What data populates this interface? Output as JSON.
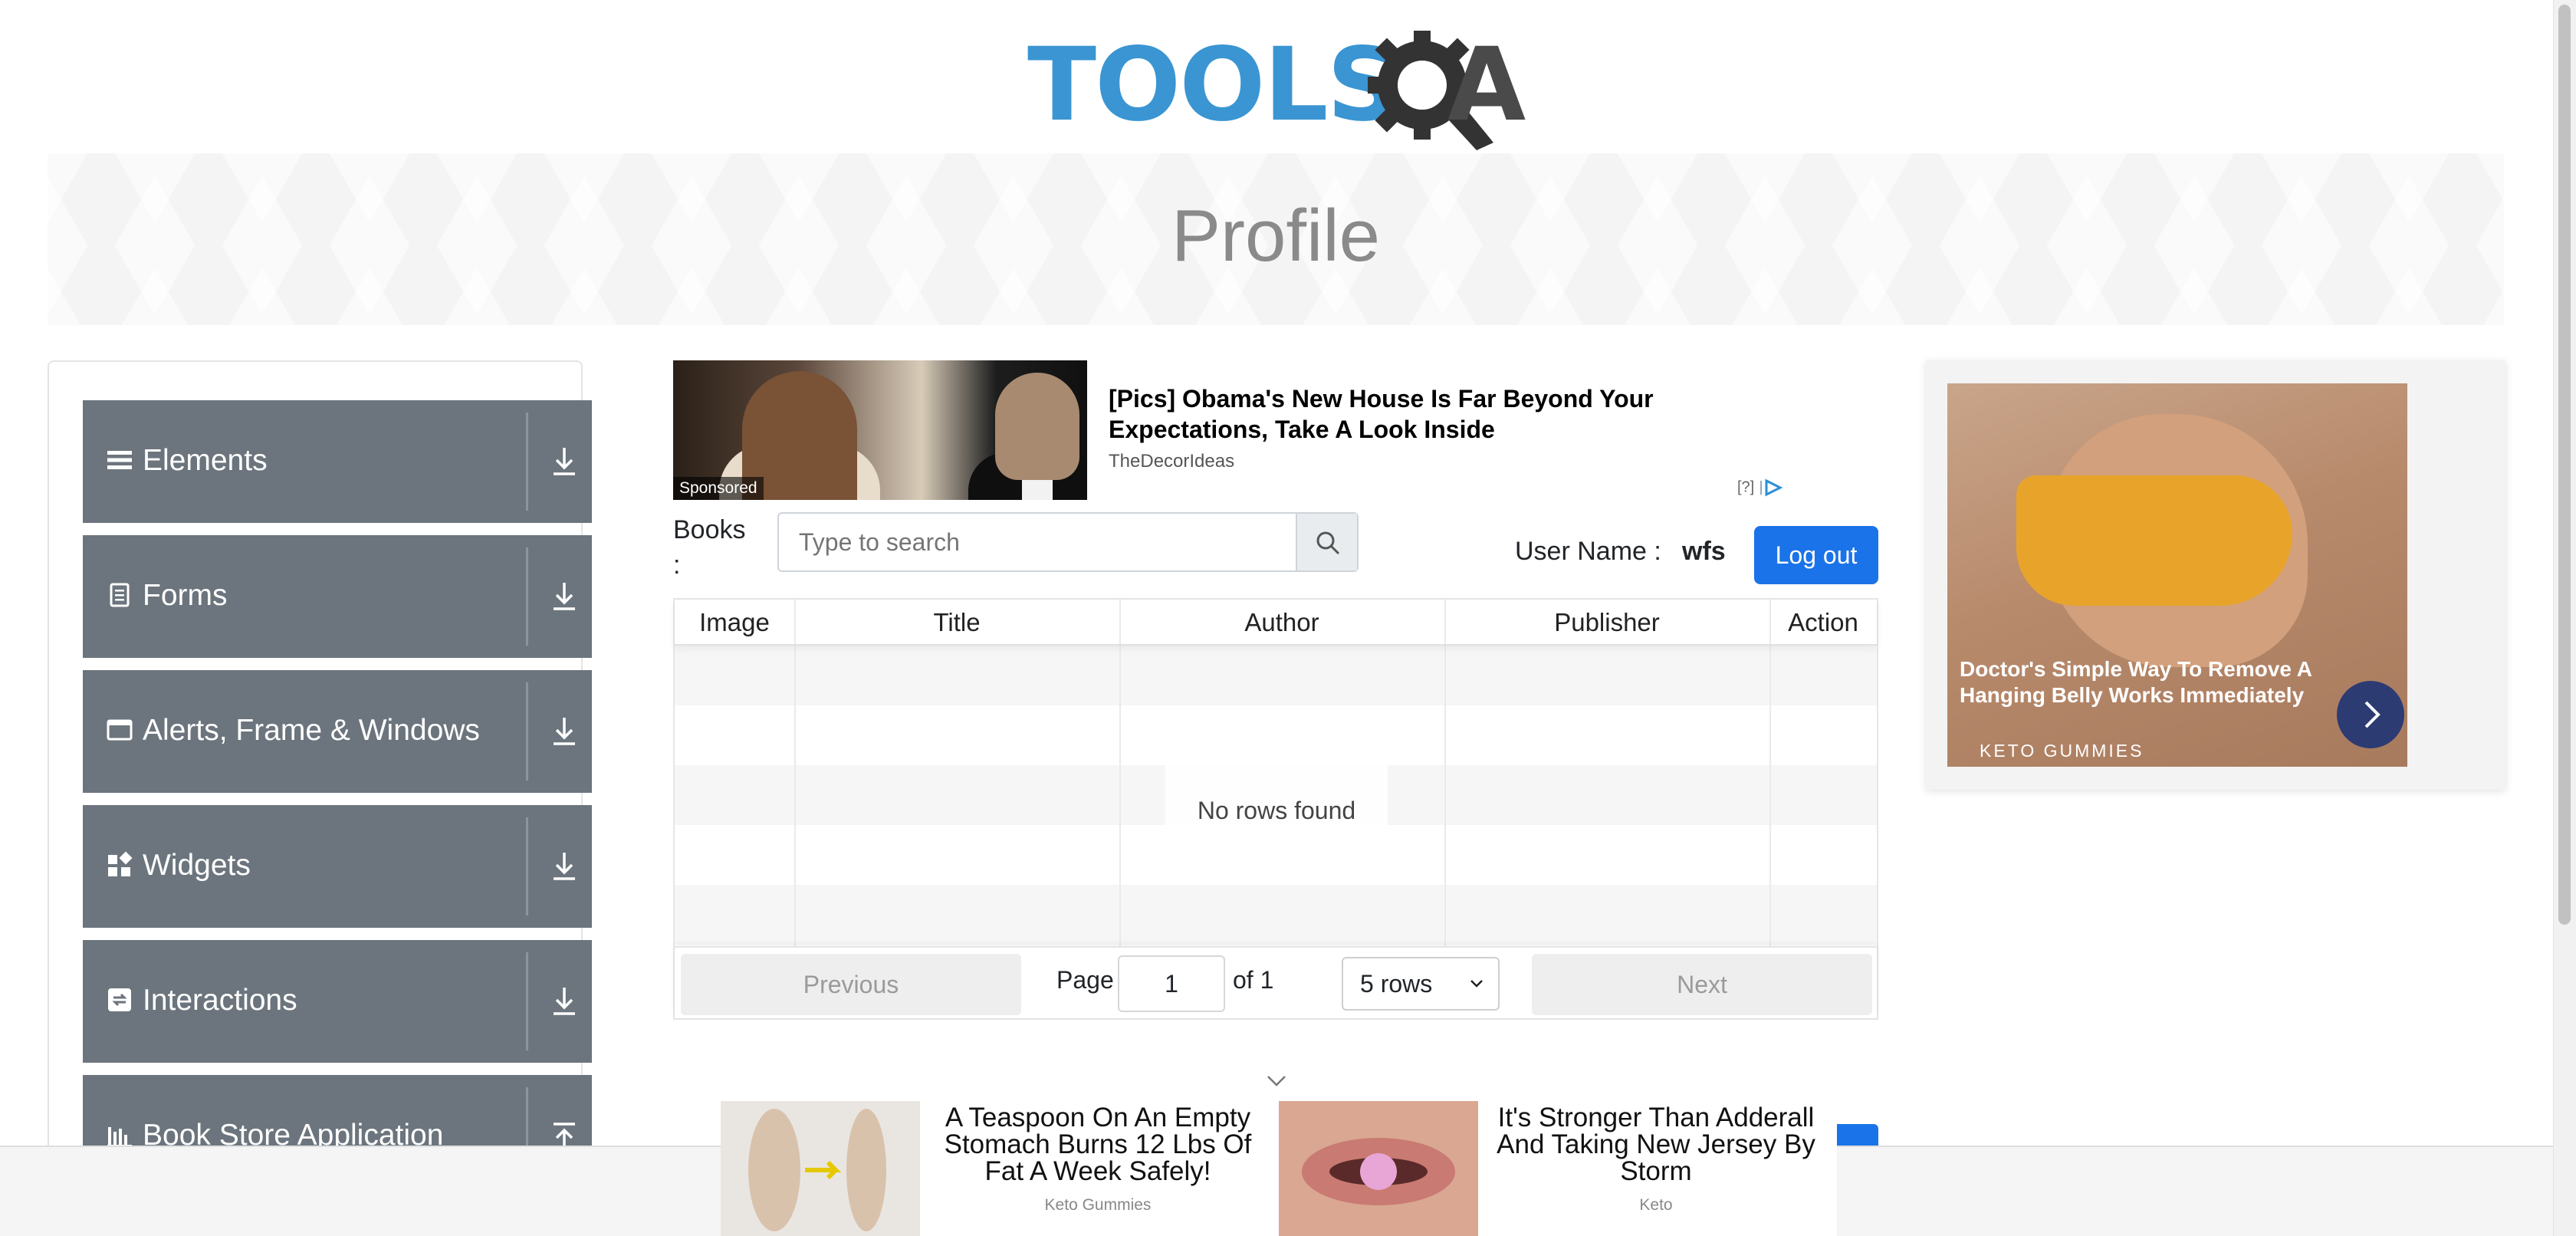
{
  "header": {
    "logo_text": "TOOLS",
    "logo_suffix": "A"
  },
  "banner": {
    "title": "Profile"
  },
  "sidebar": {
    "groups": [
      {
        "label": "Elements",
        "icon": "hamburger-icon"
      },
      {
        "label": "Forms",
        "icon": "form-icon"
      },
      {
        "label": "Alerts, Frame & Windows",
        "icon": "window-icon"
      },
      {
        "label": "Widgets",
        "icon": "widgets-icon"
      },
      {
        "label": "Interactions",
        "icon": "interactions-icon"
      },
      {
        "label": "Book Store Application",
        "icon": "bar-chart-icon"
      }
    ]
  },
  "top_ad": {
    "badge": "Sponsored",
    "headline": "[Pics] Obama's New House Is Far Beyond Your Expectations, Take A Look Inside",
    "source": "TheDecorIdeas",
    "adchoices": "[?]"
  },
  "books": {
    "label": "Books :",
    "search_placeholder": "Type to search",
    "user_label": "User Name :",
    "user_name": "wfs",
    "logout_label": "Log out"
  },
  "table": {
    "columns": [
      "Image",
      "Title",
      "Author",
      "Publisher",
      "Action"
    ],
    "rows": [],
    "empty_text": "No rows found"
  },
  "pagination": {
    "previous_label": "Previous",
    "page_label": "Page",
    "page_value": "1",
    "of_label": "of 1",
    "rows_option": "5 rows",
    "next_label": "Next"
  },
  "right_ad": {
    "headline": "Doctor's Simple Way To Remove A Hanging Belly Works Immediately",
    "brand": "KETO GUMMIES"
  },
  "bottom_ads": [
    {
      "title": "A Teaspoon On An Empty Stomach Burns 12 Lbs Of Fat A Week Safely!",
      "source": "Keto Gummies"
    },
    {
      "title": "It's Stronger Than Adderall And Taking New Jersey By Storm",
      "source": "Keto"
    }
  ],
  "colors": {
    "logo_blue": "#3a95d2",
    "logo_dark": "#4a4a4a",
    "sidebar_group": "#6c757d",
    "primary_button": "#1a73e8",
    "ad_button": "#2d3b73"
  }
}
